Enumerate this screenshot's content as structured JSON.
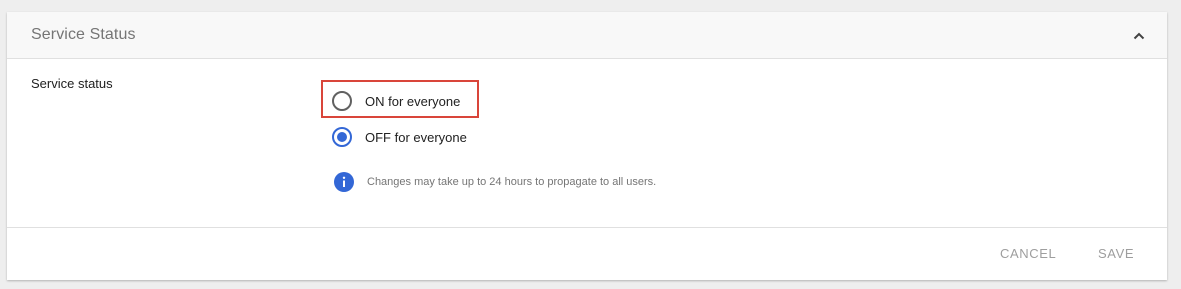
{
  "card": {
    "title": "Service Status",
    "collapse_icon": "chevron-up-icon"
  },
  "settings": {
    "label": "Service status",
    "options": [
      {
        "label": "ON for everyone",
        "selected": false,
        "highlighted": true
      },
      {
        "label": "OFF for everyone",
        "selected": true,
        "highlighted": false
      }
    ],
    "info_icon": "info-icon",
    "info_text": "Changes may take up to 24 hours to propagate to all users."
  },
  "footer": {
    "cancel_label": "CANCEL",
    "save_label": "SAVE"
  },
  "colors": {
    "accent": "#3367d6",
    "highlight": "#d9453a",
    "disabled_text": "#9e9e9e"
  }
}
